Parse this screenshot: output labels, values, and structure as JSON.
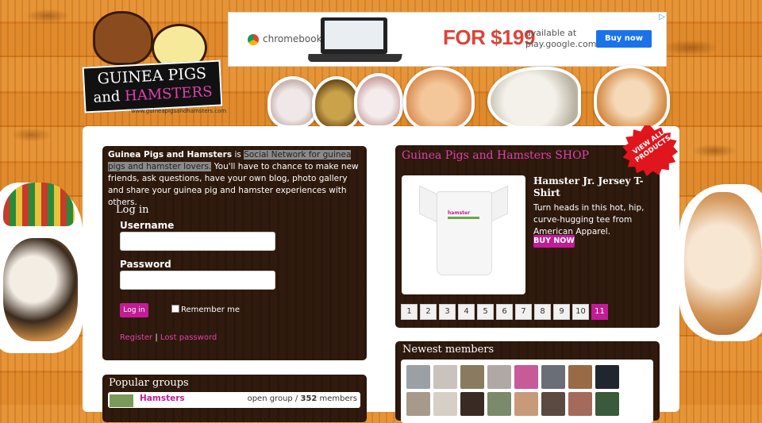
{
  "site": {
    "logo_line1": "GUINEA PIGS",
    "logo_and": "and",
    "logo_line2": "HAMSTERS",
    "logo_url": "www.guineapigsandhamsters.com"
  },
  "ad": {
    "brand": "chromebook",
    "price": "FOR $199",
    "avail_line1": "available at",
    "avail_line2": "play.google.com",
    "cta": "Buy now",
    "adchoices": "▷"
  },
  "intro": {
    "site_name": "Guinea Pigs and Hamsters",
    "is": " is ",
    "highlight": "Social Network for guinea pigs and hamster lovers.",
    "rest": " You'll have to chance to make new friends, ask questions, have your own blog, photo gallery and share your guinea pig and hamster experiences with others."
  },
  "login": {
    "heading": "Log in",
    "username_label": "Username",
    "password_label": "Password",
    "username_value": "",
    "password_value": "",
    "button": "Log in",
    "remember": "Remember me",
    "register": "Register",
    "separator": "|",
    "lost_password": "Lost password"
  },
  "groups": {
    "heading": "Popular groups",
    "items": [
      {
        "name": "Hamsters",
        "type": "open group / ",
        "count": "352",
        "suffix": " members"
      }
    ]
  },
  "shop": {
    "heading": "Guinea Pigs and Hamsters SHOP",
    "seal_line1": "VIEW ALL",
    "seal_line2": "PRODUCTS",
    "product_title": "Hamster Jr. Jersey T-Shirt",
    "product_desc": "Turn heads in this hot, hip, curve-hugging tee from American Apparel.",
    "buy_button": "BUY NOW",
    "shirt_logo": "hamster",
    "pages": [
      "1",
      "2",
      "3",
      "4",
      "5",
      "6",
      "7",
      "8",
      "9",
      "10",
      "11"
    ],
    "current_page": "11"
  },
  "members": {
    "heading": "Newest members"
  },
  "colors": {
    "accent": "#c21c96",
    "link_pink": "#e040b0",
    "panel_brown": "#2f1a0d",
    "ad_red": "#db4437",
    "ad_blue": "#1a73e8"
  }
}
